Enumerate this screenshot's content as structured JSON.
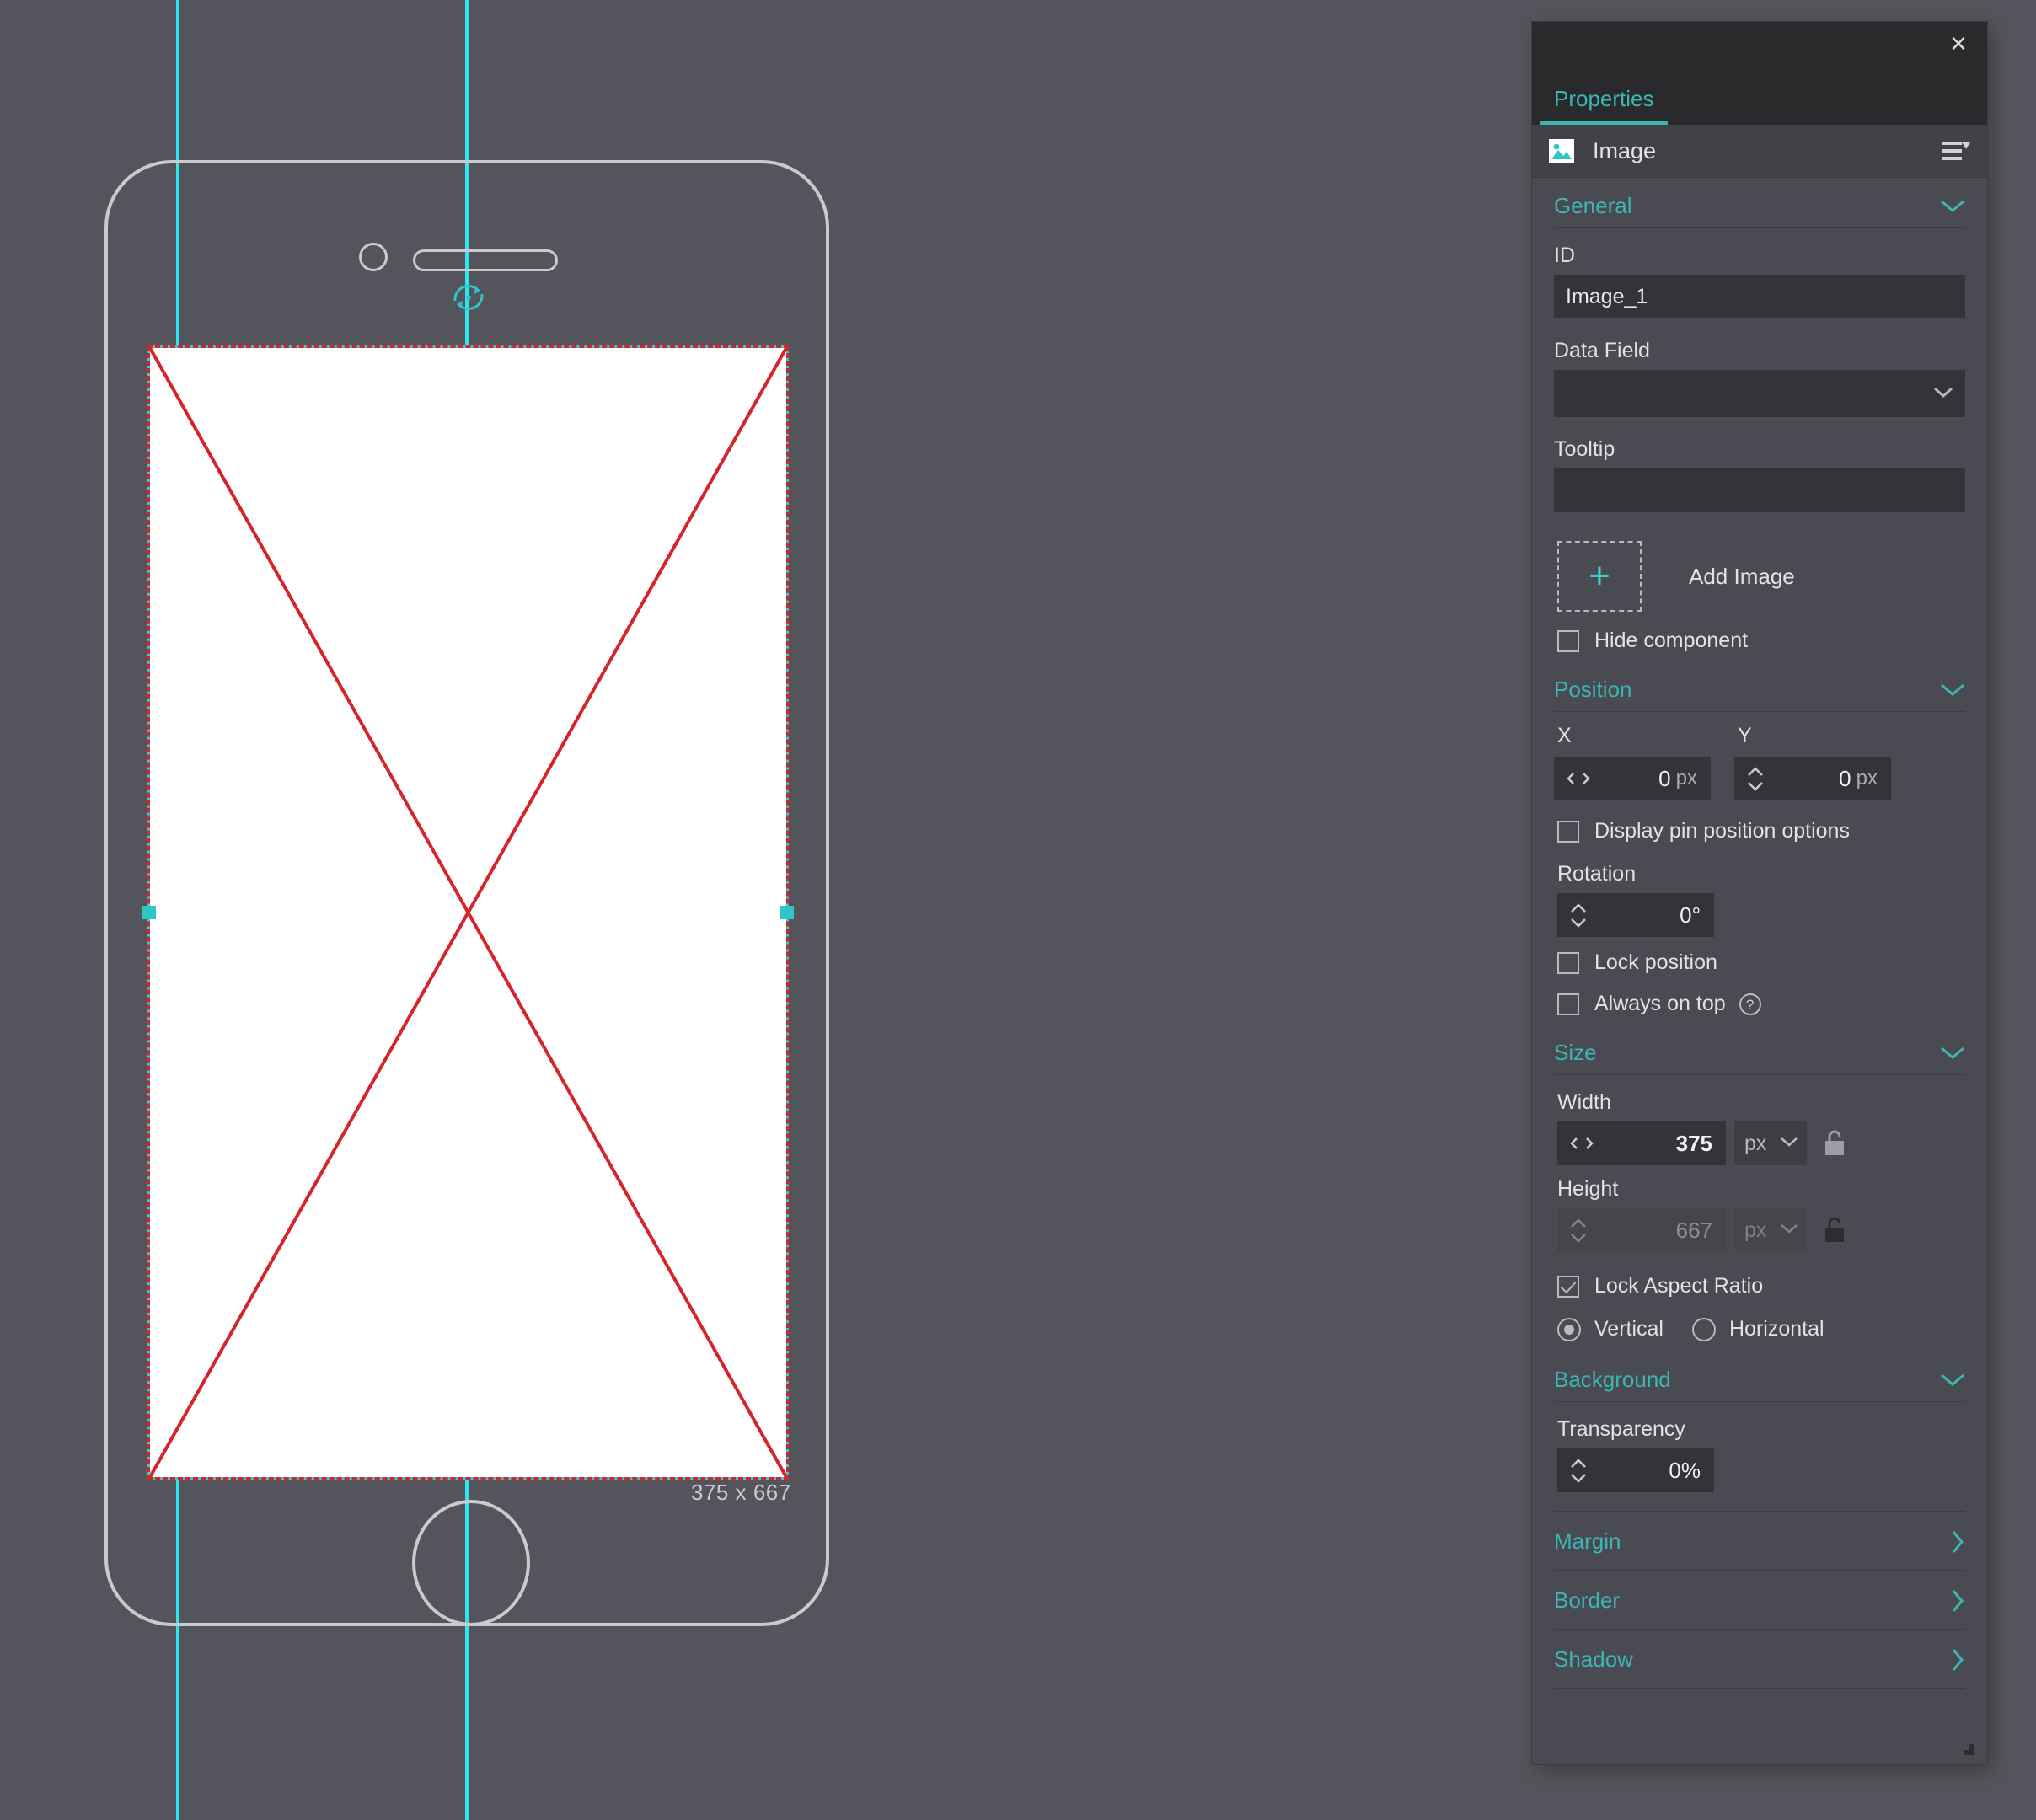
{
  "canvas": {
    "selection": {
      "dimension_label": "375 x 667",
      "rotate_handle_icon": "rotate-icon",
      "handles": [
        "left-middle",
        "right-middle"
      ]
    },
    "guides": {
      "vertical_count": 2
    },
    "device_frame": {
      "name": "phone-mockup",
      "camera_icon": "camera-icon",
      "speaker_icon": "speaker-icon",
      "home_button_icon": "home-button-icon"
    },
    "colors": {
      "background": "#54545c",
      "guide": "#2ee6ef",
      "selection_cyan": "#3fc8c8",
      "selection_red": "#d4252a",
      "frame_stroke": "#c9c9cf"
    }
  },
  "panel": {
    "close_label": "✕",
    "tabs": [
      {
        "label": "Properties",
        "active": true
      }
    ],
    "component": {
      "icon": "image-icon",
      "name": "Image",
      "menu_icon": "hamburger-menu-icon"
    },
    "accent_color": "#3ab7b4",
    "sections": {
      "general": {
        "title": "General",
        "collapse_icon": "chevron-down-icon",
        "id": {
          "label": "ID",
          "value": "Image_1",
          "placeholder": ""
        },
        "data_field": {
          "label": "Data Field",
          "value": "",
          "placeholder": ""
        },
        "tooltip": {
          "label": "Tooltip",
          "value": "",
          "placeholder": ""
        },
        "add_image": {
          "label": "Add Image",
          "plus_icon": "plus-icon"
        },
        "hide_component": {
          "label": "Hide component",
          "checked": false
        }
      },
      "position": {
        "title": "Position",
        "collapse_icon": "chevron-down-icon",
        "x": {
          "label": "X",
          "value": "0",
          "unit": "px",
          "spinner": "horizontal"
        },
        "y": {
          "label": "Y",
          "value": "0",
          "unit": "px",
          "spinner": "vertical"
        },
        "display_pin": {
          "label": "Display pin position options",
          "checked": false
        },
        "rotation": {
          "label": "Rotation",
          "value": "0°",
          "spinner": "vertical"
        },
        "lock_position": {
          "label": "Lock position",
          "checked": false
        },
        "always_on_top": {
          "label": "Always on top",
          "checked": false,
          "help_icon": "help-icon",
          "help_label": "?"
        }
      },
      "size": {
        "title": "Size",
        "collapse_icon": "chevron-down-icon",
        "width": {
          "label": "Width",
          "value": "375",
          "unit": "px",
          "spinner": "horizontal",
          "locked": false,
          "disabled": false,
          "lock_icon": "unlock-icon"
        },
        "height": {
          "label": "Height",
          "value": "667",
          "unit": "px",
          "spinner": "vertical",
          "locked": false,
          "disabled": true,
          "lock_icon": "unlock-icon"
        },
        "lock_aspect_ratio": {
          "label": "Lock Aspect Ratio",
          "checked": true
        },
        "orientation": {
          "options": [
            {
              "label": "Vertical",
              "selected": true
            },
            {
              "label": "Horizontal",
              "selected": false
            }
          ]
        }
      },
      "background": {
        "title": "Background",
        "collapse_icon": "chevron-down-icon",
        "transparency": {
          "label": "Transparency",
          "value": "0%",
          "spinner": "vertical"
        }
      },
      "collapsed": [
        {
          "title": "Margin",
          "expand_icon": "chevron-right-icon"
        },
        {
          "title": "Border",
          "expand_icon": "chevron-right-icon"
        },
        {
          "title": "Shadow",
          "expand_icon": "chevron-right-icon"
        }
      ]
    },
    "resize_grip_icon": "resize-grip-icon"
  }
}
